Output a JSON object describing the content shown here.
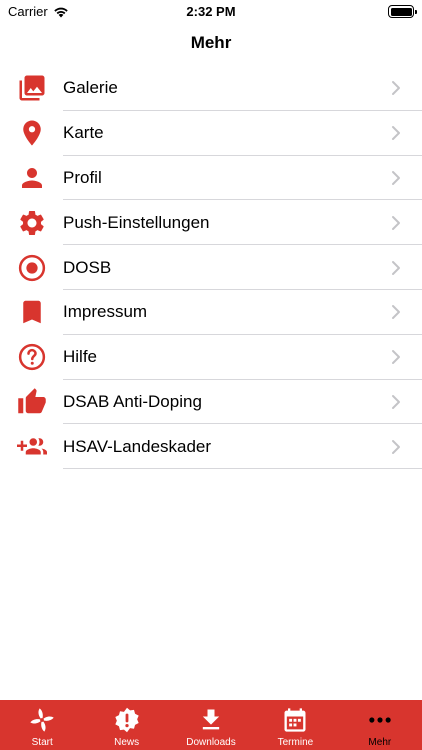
{
  "status_bar": {
    "carrier": "Carrier",
    "time": "2:32 PM"
  },
  "nav": {
    "title": "Mehr"
  },
  "menu": {
    "items": [
      {
        "label": "Galerie",
        "icon": "gallery-icon"
      },
      {
        "label": "Karte",
        "icon": "map-pin-icon"
      },
      {
        "label": "Profil",
        "icon": "person-icon"
      },
      {
        "label": "Push-Einstellungen",
        "icon": "gear-icon"
      },
      {
        "label": "DOSB",
        "icon": "radio-circle-icon"
      },
      {
        "label": "Impressum",
        "icon": "bookmark-icon"
      },
      {
        "label": "Hilfe",
        "icon": "help-circle-icon"
      },
      {
        "label": "DSAB Anti-Doping",
        "icon": "thumbs-up-icon"
      },
      {
        "label": "HSAV-Landeskader",
        "icon": "add-group-icon"
      }
    ]
  },
  "tab_bar": {
    "tabs": [
      {
        "label": "Start",
        "icon": "pinwheel-icon"
      },
      {
        "label": "News",
        "icon": "alert-badge-icon"
      },
      {
        "label": "Downloads",
        "icon": "download-icon"
      },
      {
        "label": "Termine",
        "icon": "calendar-icon"
      },
      {
        "label": "Mehr",
        "icon": "more-dots-icon",
        "active": true
      }
    ]
  },
  "colors": {
    "accent": "#d8352e",
    "chevron": "#c4c4c7",
    "separator": "#d7d7db",
    "active_tab": "#000000",
    "inactive_tab": "#ffffff"
  }
}
